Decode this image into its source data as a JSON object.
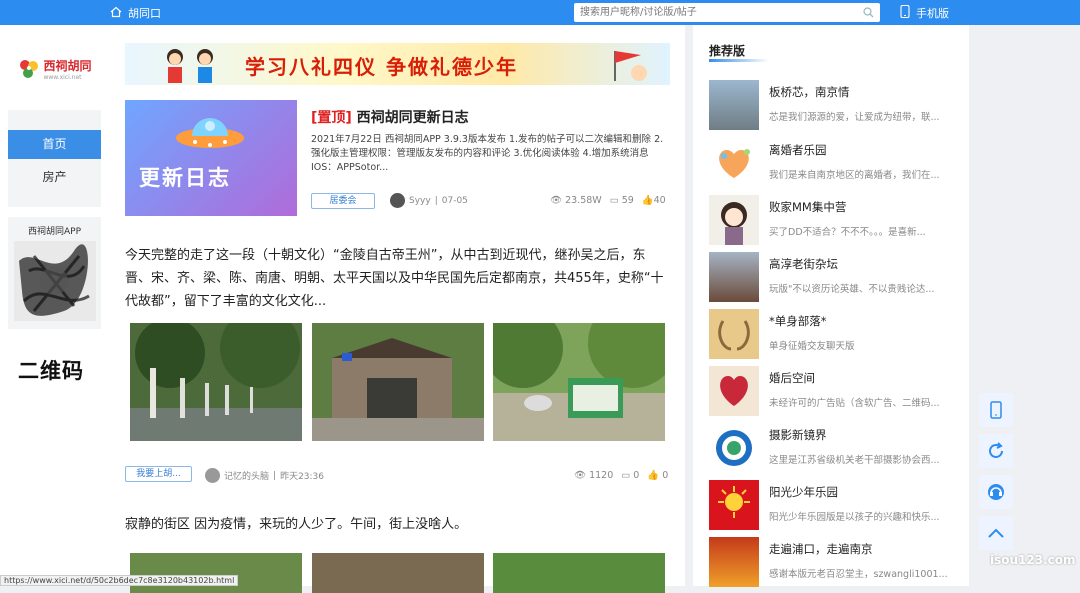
{
  "topbar": {
    "home_label": "胡同口",
    "search_placeholder": "搜索用户昵称/讨论版/帖子",
    "mobile_label": "手机版"
  },
  "logo": {
    "text": "西祠胡同",
    "sub": "www.xici.net"
  },
  "nav": {
    "items": [
      {
        "label": "首页",
        "active": true
      },
      {
        "label": "房产",
        "active": false
      }
    ]
  },
  "qr": {
    "label": "西祠胡同APP",
    "title": "二维码"
  },
  "banner": {
    "text": "学习八礼四仪  争做礼德少年"
  },
  "post1": {
    "image_text": "更新日志",
    "tag": "[置顶]",
    "title": "西祠胡同更新日志",
    "desc": "2021年7月22日 西祠胡同APP 3.9.3版本发布 1.发布的帖子可以二次编辑和删除 2.强化版主管理权限：管理版友发布的内容和评论 3.优化阅读体验 4.增加系统消息 IOS：APPSotor...",
    "board": "居委会",
    "author": "Syyy",
    "date": "07-05",
    "views": "23.58W",
    "comments": "59",
    "likes": "40"
  },
  "post2": {
    "text": "今天完整的走了这一段（十朝文化）“金陵自古帝王州”，从中古到近现代，继孙吴之后，东晋、宋、齐、梁、陈、南唐、明朝、太平天国以及中华民国先后定都南京，共455年，史称“十代故都”，留下了丰富的文化文化...",
    "board": "我要上胡...",
    "author": "记忆的头脑",
    "date": "昨天23:36",
    "views": "1120",
    "comments": "0",
    "likes": "0"
  },
  "post3": {
    "text": "寂静的街区 因为疫情，来玩的人少了。午间，街上没啥人。"
  },
  "recommend": {
    "title": "推荐版",
    "items": [
      {
        "name": "板桥芯，南京情",
        "desc": "芯是我们源源的爱，让爱成为纽带，联..."
      },
      {
        "name": "离婚者乐园",
        "desc": "我们是来自南京地区的离婚者，我们在..."
      },
      {
        "name": "败家MM集中营",
        "desc": "买了DD不适合？不不不。。。是喜新..."
      },
      {
        "name": "高淳老街杂坛",
        "desc": "玩版\"不以资历论英雄、不以贵贱论达..."
      },
      {
        "name": "*单身部落*",
        "desc": "单身征婚交友聊天版"
      },
      {
        "name": "婚后空间",
        "desc": "未经许可的广告贴（含软广告、二维码..."
      },
      {
        "name": "摄影新镜界",
        "desc": "这里是江苏省级机关老干部摄影协会西..."
      },
      {
        "name": "阳光少年乐园",
        "desc": "阳光少年乐园版是以孩子的兴趣和快乐..."
      },
      {
        "name": "走遍浦口，走遍南京",
        "desc": "感谢本版元老百忍堂主，szwangli1001..."
      }
    ]
  },
  "statusbar": {
    "url": "https://www.xici.net/d/50c2b6dec7c8e3120b43102b.html"
  },
  "watermark": "isou123.com"
}
